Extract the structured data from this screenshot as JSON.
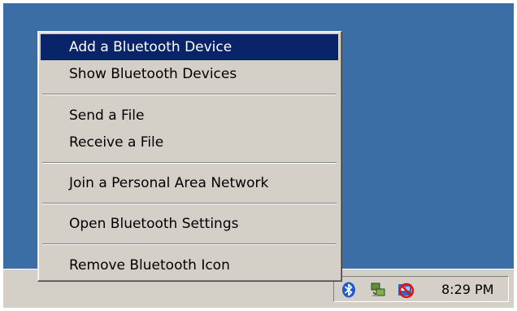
{
  "menu": {
    "items": [
      {
        "label": "Add a Bluetooth Device"
      },
      {
        "label": "Show Bluetooth Devices"
      },
      {
        "label": "Send a File"
      },
      {
        "label": "Receive a File"
      },
      {
        "label": "Join a Personal Area Network"
      },
      {
        "label": "Open Bluetooth Settings"
      },
      {
        "label": "Remove Bluetooth Icon"
      }
    ]
  },
  "tray": {
    "icons": [
      "bluetooth-icon",
      "network-icon",
      "security-alert-icon"
    ],
    "clock": "8:29 PM"
  },
  "colors": {
    "desktop": "#3a6ea5",
    "highlight": "#0a246a",
    "menu_bg": "#d4d0c8",
    "bluetooth_blue": "#1e5ad0"
  }
}
